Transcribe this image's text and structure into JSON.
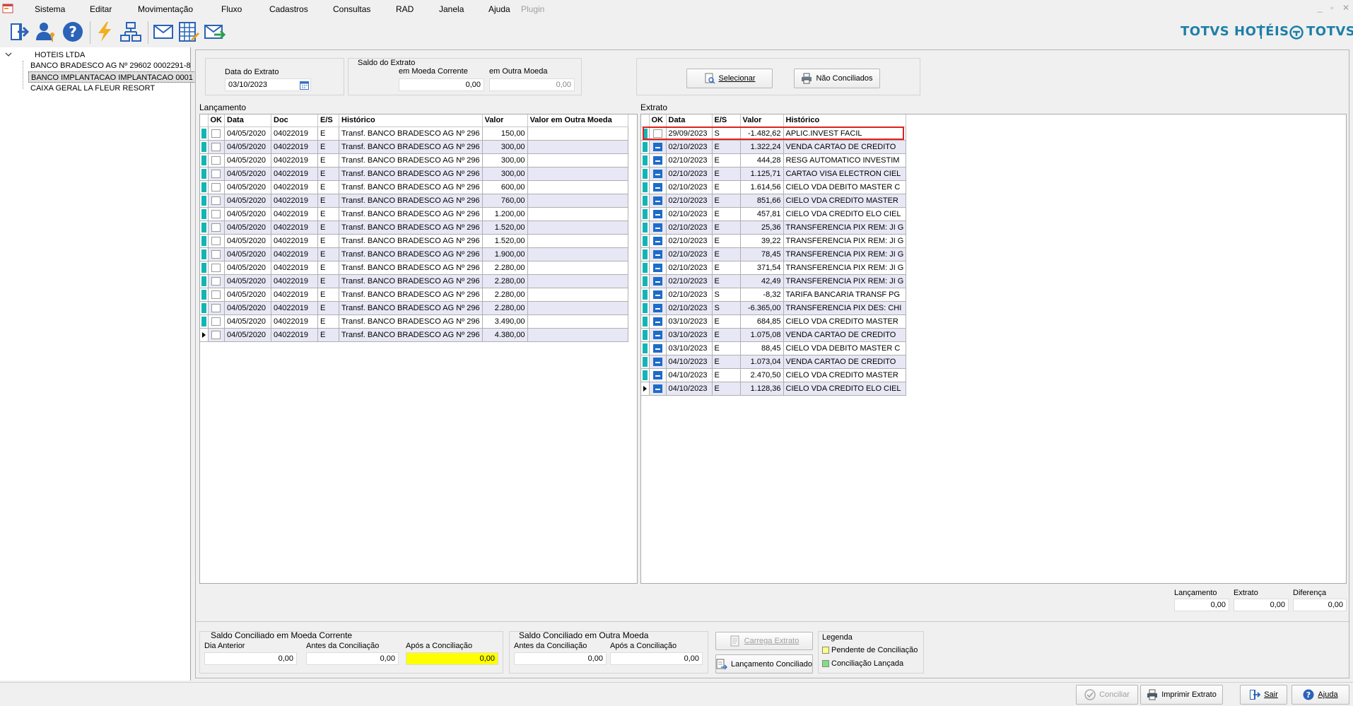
{
  "menu": {
    "items": [
      "Sistema",
      "Editar",
      "Movimentação",
      "Fluxo",
      "Cadastros",
      "Consultas",
      "RAD",
      "Janela",
      "Ajuda"
    ],
    "plugin": "Plugin",
    "window_controls": [
      "_",
      "▫",
      "✕"
    ]
  },
  "toolbar": {
    "icons": [
      "exit-icon",
      "user-key-icon",
      "help-icon",
      "lightning-icon",
      "diagram-icon",
      "mail-icon",
      "grid-edit-icon",
      "mail-arrow-icon"
    ]
  },
  "brand": {
    "left": "TOTVS HOTÉIS",
    "right": "TOTVS"
  },
  "tree": {
    "root": "HOTEIS LTDA",
    "children": [
      "BANCO BRADESCO AG Nº 29602 0002291-8",
      "BANCO IMPLANTACAO IMPLANTACAO 0001",
      "CAIXA GERAL LA FLEUR RESORT"
    ]
  },
  "header": {
    "data_extrato_label": "Data do Extrato",
    "data_extrato_value": "03/10/2023",
    "saldo_title": "Saldo do Extrato",
    "moeda_corrente_label": "em Moeda Corrente",
    "moeda_corrente_value": "0,00",
    "outra_moeda_label": "em Outra Moeda",
    "outra_moeda_value": "0,00",
    "selecionar_label": "Selecionar",
    "nao_conciliados_label": "Não Conciliados"
  },
  "lancamento": {
    "title": "Lançamento",
    "columns": [
      "OK",
      "Data",
      "Doc",
      "E/S",
      "Histórico",
      "Valor",
      "Valor em Outra Moeda"
    ],
    "rows": [
      [
        "04/05/2020",
        "04022019",
        "E",
        "Transf. BANCO BRADESCO AG Nº 296",
        "150,00",
        ""
      ],
      [
        "04/05/2020",
        "04022019",
        "E",
        "Transf. BANCO BRADESCO AG Nº 296",
        "300,00",
        ""
      ],
      [
        "04/05/2020",
        "04022019",
        "E",
        "Transf. BANCO BRADESCO AG Nº 296",
        "300,00",
        ""
      ],
      [
        "04/05/2020",
        "04022019",
        "E",
        "Transf. BANCO BRADESCO AG Nº 296",
        "300,00",
        ""
      ],
      [
        "04/05/2020",
        "04022019",
        "E",
        "Transf. BANCO BRADESCO AG Nº 296",
        "600,00",
        ""
      ],
      [
        "04/05/2020",
        "04022019",
        "E",
        "Transf. BANCO BRADESCO AG Nº 296",
        "760,00",
        ""
      ],
      [
        "04/05/2020",
        "04022019",
        "E",
        "Transf. BANCO BRADESCO AG Nº 296",
        "1.200,00",
        ""
      ],
      [
        "04/05/2020",
        "04022019",
        "E",
        "Transf. BANCO BRADESCO AG Nº 296",
        "1.520,00",
        ""
      ],
      [
        "04/05/2020",
        "04022019",
        "E",
        "Transf. BANCO BRADESCO AG Nº 296",
        "1.520,00",
        ""
      ],
      [
        "04/05/2020",
        "04022019",
        "E",
        "Transf. BANCO BRADESCO AG Nº 296",
        "1.900,00",
        ""
      ],
      [
        "04/05/2020",
        "04022019",
        "E",
        "Transf. BANCO BRADESCO AG Nº 296",
        "2.280,00",
        ""
      ],
      [
        "04/05/2020",
        "04022019",
        "E",
        "Transf. BANCO BRADESCO AG Nº 296",
        "2.280,00",
        ""
      ],
      [
        "04/05/2020",
        "04022019",
        "E",
        "Transf. BANCO BRADESCO AG Nº 296",
        "2.280,00",
        ""
      ],
      [
        "04/05/2020",
        "04022019",
        "E",
        "Transf. BANCO BRADESCO AG Nº 296",
        "2.280,00",
        ""
      ],
      [
        "04/05/2020",
        "04022019",
        "E",
        "Transf. BANCO BRADESCO AG Nº 296",
        "3.490,00",
        ""
      ],
      [
        "04/05/2020",
        "04022019",
        "E",
        "Transf. BANCO BRADESCO AG Nº 296",
        "4.380,00",
        ""
      ]
    ]
  },
  "extrato": {
    "title": "Extrato",
    "columns": [
      "OK",
      "Data",
      "E/S",
      "Valor",
      "Histórico"
    ],
    "rows": [
      [
        "29/09/2023",
        "S",
        "-1.482,62",
        "APLIC.INVEST FACIL",
        false
      ],
      [
        "02/10/2023",
        "E",
        "1.322,24",
        "VENDA CARTAO DE CREDITO",
        true
      ],
      [
        "02/10/2023",
        "E",
        "444,28",
        "RESG AUTOMATICO INVESTIM",
        true
      ],
      [
        "02/10/2023",
        "E",
        "1.125,71",
        "CARTAO VISA ELECTRON CIEL",
        true
      ],
      [
        "02/10/2023",
        "E",
        "1.614,56",
        "CIELO VDA DEBITO MASTER C",
        true
      ],
      [
        "02/10/2023",
        "E",
        "851,66",
        "CIELO VDA CREDITO MASTER",
        true
      ],
      [
        "02/10/2023",
        "E",
        "457,81",
        "CIELO VDA CREDITO ELO CIEL",
        true
      ],
      [
        "02/10/2023",
        "E",
        "25,36",
        "TRANSFERENCIA PIX REM: JI G",
        true
      ],
      [
        "02/10/2023",
        "E",
        "39,22",
        "TRANSFERENCIA PIX REM: JI G",
        true
      ],
      [
        "02/10/2023",
        "E",
        "78,45",
        "TRANSFERENCIA PIX REM: JI G",
        true
      ],
      [
        "02/10/2023",
        "E",
        "371,54",
        "TRANSFERENCIA PIX REM: JI G",
        true
      ],
      [
        "02/10/2023",
        "E",
        "42,49",
        "TRANSFERENCIA PIX REM: JI G",
        true
      ],
      [
        "02/10/2023",
        "S",
        "-8,32",
        "TARIFA BANCARIA TRANSF PG",
        true
      ],
      [
        "02/10/2023",
        "S",
        "-6.365,00",
        "TRANSFERENCIA PIX DES: CHI",
        true
      ],
      [
        "03/10/2023",
        "E",
        "684,85",
        "CIELO VDA CREDITO MASTER",
        true
      ],
      [
        "03/10/2023",
        "E",
        "1.075,08",
        "VENDA CARTAO DE CREDITO",
        true
      ],
      [
        "03/10/2023",
        "E",
        "88,45",
        "CIELO VDA DEBITO MASTER C",
        true
      ],
      [
        "04/10/2023",
        "E",
        "1.073,04",
        "VENDA CARTAO DE CREDITO",
        true
      ],
      [
        "04/10/2023",
        "E",
        "2.470,50",
        "CIELO VDA CREDITO MASTER",
        true
      ],
      [
        "04/10/2023",
        "E",
        "1.128,36",
        "CIELO VDA CREDITO ELO CIEL",
        true
      ]
    ]
  },
  "totals": {
    "lancamento_label": "Lançamento",
    "lancamento_value": "0,00",
    "extrato_label": "Extrato",
    "extrato_value": "0,00",
    "diferenca_label": "Diferença",
    "diferenca_value": "0,00"
  },
  "bottom": {
    "saldo_corrente_title": "Saldo Conciliado em Moeda Corrente",
    "dia_anterior_label": "Dia Anterior",
    "dia_anterior_value": "0,00",
    "antes_label": "Antes da Conciliação",
    "antes_value": "0,00",
    "apos_label": "Após a Conciliação",
    "apos_value": "0,00",
    "saldo_outra_title": "Saldo Conciliado em Outra Moeda",
    "antes2_label": "Antes da Conciliação",
    "antes2_value": "0,00",
    "apos2_label": "Após a Conciliação",
    "apos2_value": "0,00",
    "carrega_label": "Carrega Extrato",
    "lanc_conciliado_label": "Lançamento Conciliado",
    "legenda_title": "Legenda",
    "pendente_label": "Pendente de Conciliação",
    "lancada_label": "Conciliação Lançada",
    "pendente_color": "#ffff80",
    "lancada_color": "#80e080",
    "apos_highlight": "#ffff00"
  },
  "status": {
    "conciliar_label": "Conciliar",
    "imprimir_label": "Imprimir Extrato",
    "sair_label": "Sair",
    "ajuda_label": "Ajuda"
  }
}
